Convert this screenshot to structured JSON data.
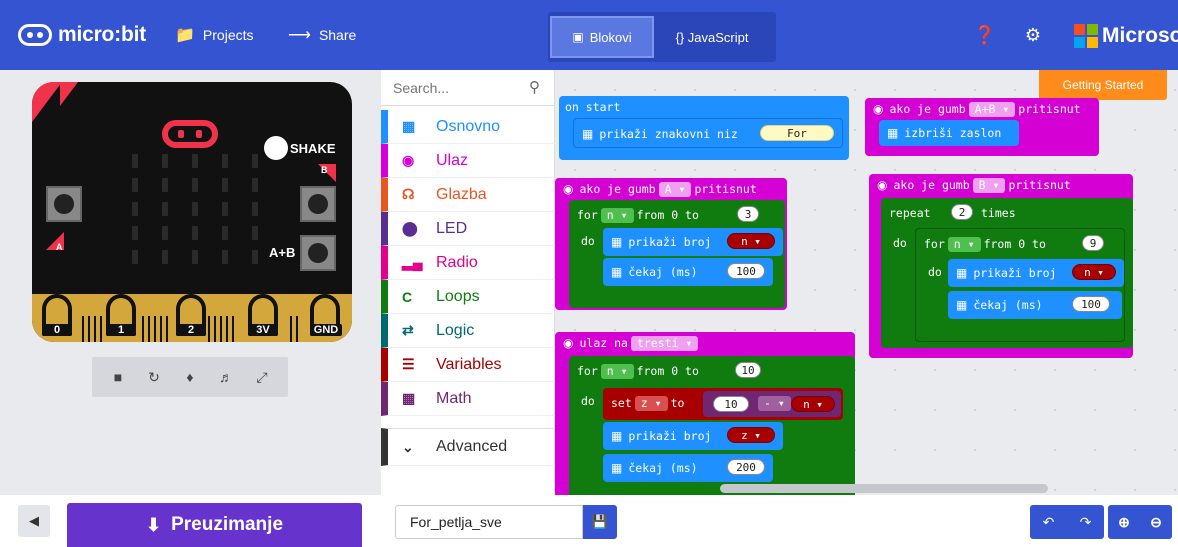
{
  "header": {
    "logo_text": "micro:bit",
    "projects_label": "Projects",
    "share_label": "Share",
    "blocks_tab": "Blokovi",
    "javascript_tab": "{} JavaScript",
    "brand": "Microsoft"
  },
  "simulator": {
    "shake_label": "SHAKE",
    "button_a_label": "A",
    "button_b_label": "B",
    "button_ab_label": "A+B",
    "pins": [
      "0",
      "1",
      "2",
      "3V",
      "GND"
    ]
  },
  "toolbox": {
    "search_placeholder": "Search...",
    "categories": [
      {
        "label": "Osnovno",
        "color": "#1e90ff",
        "icon": "grid-icon"
      },
      {
        "label": "Ulaz",
        "color": "#d400d4",
        "icon": "target-icon"
      },
      {
        "label": "Glazba",
        "color": "#e65722",
        "icon": "headphones-icon"
      },
      {
        "label": "LED",
        "color": "#5c2d91",
        "icon": "toggle-icon"
      },
      {
        "label": "Radio",
        "color": "#e3008c",
        "icon": "signal-icon"
      },
      {
        "label": "Loops",
        "color": "#107c10",
        "icon": "loop-icon"
      },
      {
        "label": "Logic",
        "color": "#006970",
        "icon": "shuffle-icon"
      },
      {
        "label": "Variables",
        "color": "#a80000",
        "icon": "lines-icon"
      },
      {
        "label": "Math",
        "color": "#712672",
        "icon": "calculator-icon"
      }
    ],
    "advanced_label": "Advanced"
  },
  "workspace": {
    "getting_started": "Getting Started",
    "on_start": "on start",
    "show_string": "prikaži znakovni niz",
    "string_value": "For",
    "on_button_a": {
      "prefix": "ako je gumb",
      "button": "A",
      "suffix": "pritisnut"
    },
    "on_button_ab": {
      "prefix": "ako je gumb",
      "button": "A+B",
      "suffix": "pritisnut"
    },
    "on_button_b": {
      "prefix": "ako je gumb",
      "button": "B",
      "suffix": "pritisnut"
    },
    "clear_screen": "izbriši zaslon",
    "for_label": "for",
    "from_label": "from 0 to",
    "do_label": "do",
    "var_n": "n",
    "var_z": "z",
    "show_number": "prikaži broj",
    "pause": "čekaj (ms)",
    "repeat": "repeat",
    "times": "times",
    "on_shake": "ulaz na",
    "shake_gesture": "tresti",
    "set": "set",
    "to": "to",
    "minus": "-",
    "values": {
      "loop_a_to": "3",
      "pause_a": "100",
      "repeat_b": "2",
      "loop_b_to": "9",
      "pause_b": "100",
      "loop_shake_to": "10",
      "set_left": "10",
      "pause_shake": "200"
    }
  },
  "footer": {
    "download_label": "Preuzimanje",
    "project_name": "For_petlja_sve"
  }
}
